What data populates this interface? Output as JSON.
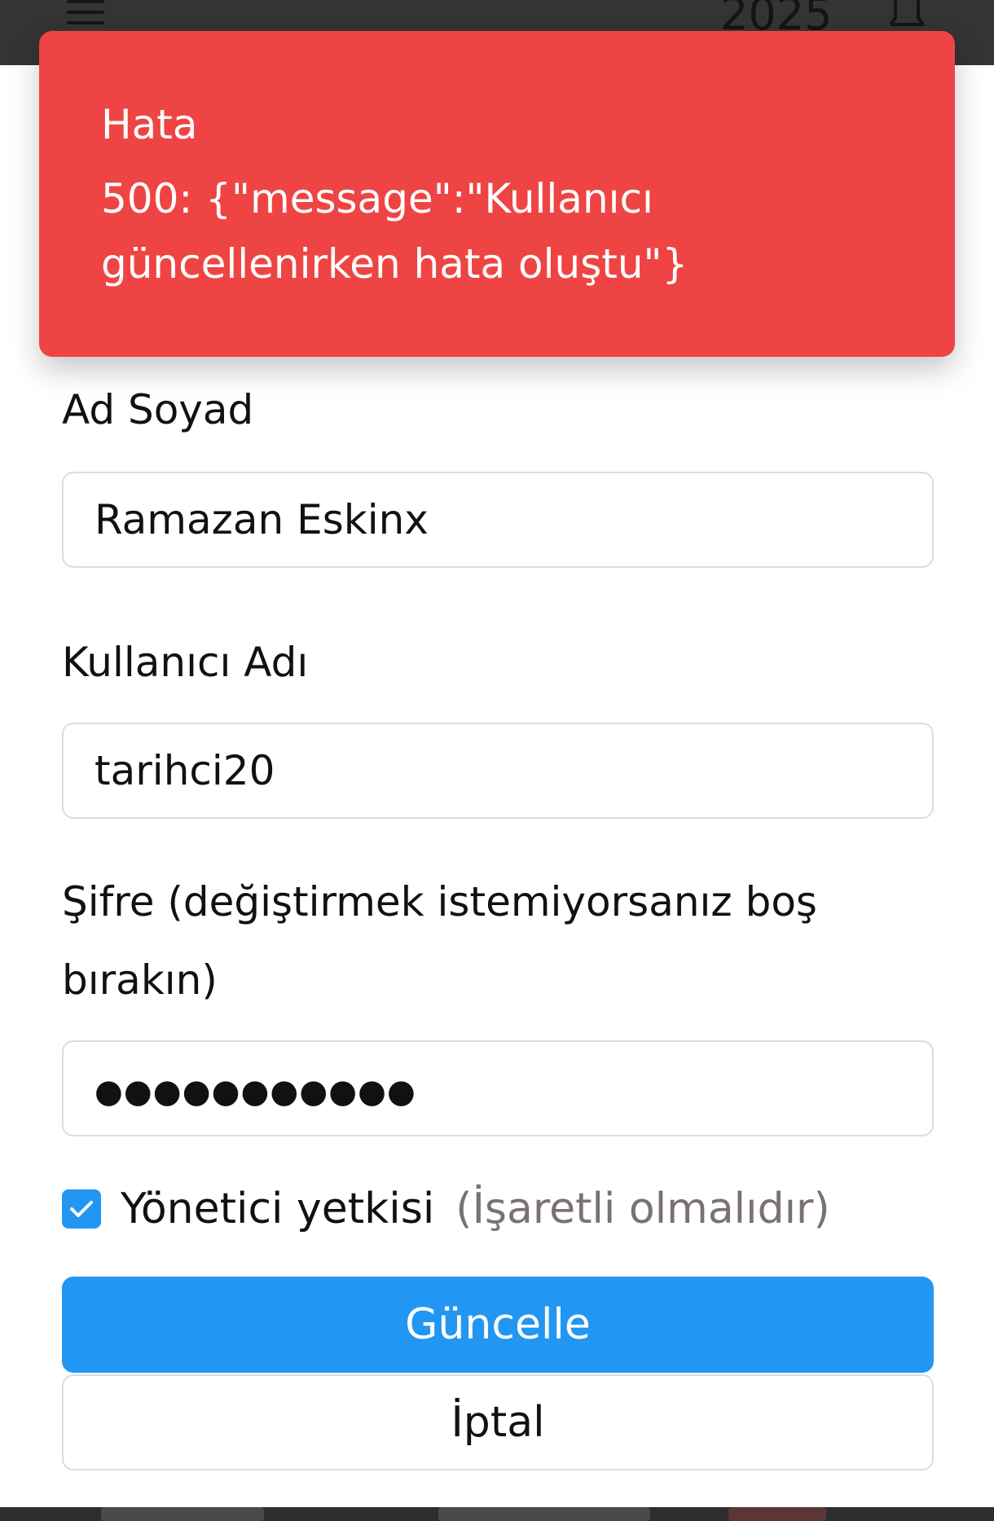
{
  "app_bar": {
    "year": "2025",
    "menu_icon": "menu-icon",
    "bell_icon": "bell-icon"
  },
  "toast": {
    "title": "Hata",
    "message": "500: {\"message\":\"Kullanıcı güncellenirken hata oluştu\"}",
    "color": "#ef4444"
  },
  "form": {
    "full_name": {
      "label": "Ad Soyad",
      "value": "Ramazan Eskinx"
    },
    "username": {
      "label": "Kullanıcı Adı",
      "value": "tarihci20"
    },
    "password": {
      "label": "Şifre (değiştirmek istemiyorsanız boş bırakın)",
      "value": "●●●●●●●●●●●"
    },
    "admin": {
      "label": "Yönetici yetkisi",
      "hint": "(İşaretli olmalıdır)",
      "checked": true
    },
    "update_button": "Güncelle",
    "cancel_button": "İptal"
  },
  "colors": {
    "primary": "#2196f3",
    "error": "#ef4444",
    "hint": "#7a7270"
  }
}
